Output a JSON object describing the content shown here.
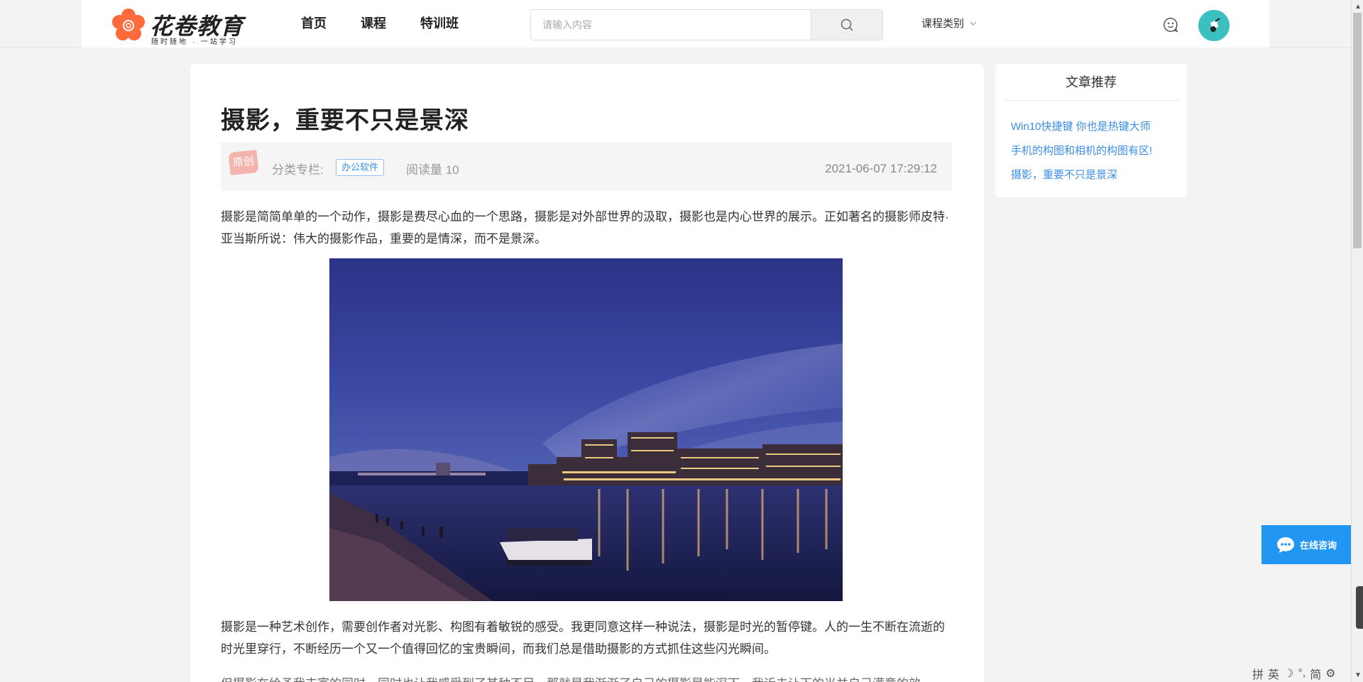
{
  "brand": {
    "name": "花卷教育",
    "slogan": "随时随地 · 一站学习",
    "color": "#ff6a3d"
  },
  "nav": {
    "items": [
      "首页",
      "课程",
      "特训班"
    ]
  },
  "search": {
    "placeholder": "请输入内容",
    "icon": "search-icon"
  },
  "course_category": {
    "label": "课程类别"
  },
  "header_icons": {
    "chat": "smile-chat-icon",
    "avatar": "user-avatar"
  },
  "article": {
    "title": "摄影，重要不只是景深",
    "original_badge": "原创",
    "category_label": "分类专栏:",
    "category_tag": "办公软件",
    "reads": "阅读量 10",
    "date": "2021-06-07 17:29:12",
    "paragraphs": [
      "摄影是简简单单的一个动作，摄影是费尽心血的一个思路，摄影是对外部世界的汲取，摄影也是内心世界的展示。正如著名的摄影师皮特·亚当斯所说：伟大的摄影作品，重要的是情深，而不是景深。",
      "摄影是一种艺术创作，需要创作者对光影、构图有着敏锐的感受。我更同意这样一种说法，摄影是时光的暂停键。人的一生不断在流逝的时光里穿行，不断经历一个又一个值得回忆的宝贵瞬间，而我们总是借助摄影的方式抓住这些闪光瞬间。",
      "但摄影在给予我丰富的同时，同时也让我感受到了其种不足，那就是我渐渐了自己的摄影是能深下，我诉未让下的当并自己满意的效"
    ]
  },
  "sidebar": {
    "title": "文章推荐",
    "links": [
      "Win10快捷键 你也是热键大师",
      "手机的构图和相机的构图有区!",
      "摄影，重要不只是景深"
    ]
  },
  "consult": {
    "label": "在线咨询"
  },
  "ime": {
    "items": [
      "拼",
      "英",
      "☽",
      "°,",
      "简",
      "⚙"
    ]
  },
  "colors": {
    "link": "#3a8ee6",
    "consult_bg": "#2196f3",
    "avatar_bg": "#3cbfbf"
  }
}
